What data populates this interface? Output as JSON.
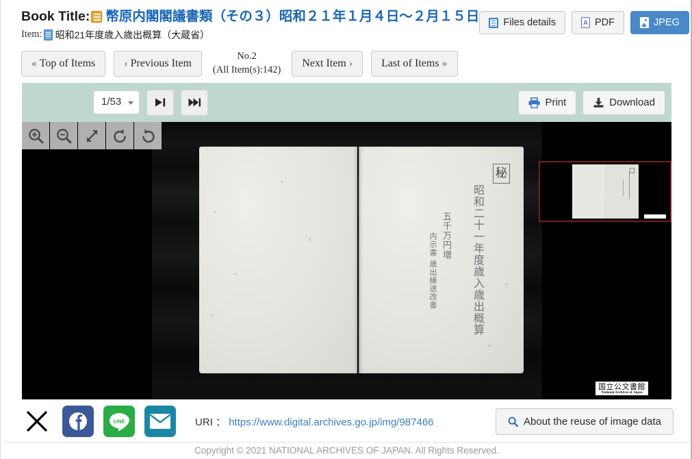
{
  "header": {
    "book_title_label": "Book Title:",
    "book_title_value": "幣原内閣閣議書類（その３）昭和２１年１月４日〜２月１５日",
    "item_label": "Item:",
    "item_value": "昭和21年度歳入歳出概算（大蔵省）",
    "actions": [
      {
        "name": "files-details",
        "label": "Files details",
        "icon": "list-icon",
        "primary": false
      },
      {
        "name": "pdf",
        "label": "PDF",
        "icon": "pdf-icon",
        "primary": false
      },
      {
        "name": "jpeg",
        "label": "JPEG",
        "icon": "image-icon",
        "primary": true
      }
    ]
  },
  "item_nav": {
    "top_of_items": "Top of Items",
    "previous_item": "Previous Item",
    "next_item": "Next Item",
    "last_of_items": "Last of Items",
    "chev_first": "«",
    "chev_prev": "‹",
    "chev_next": "›",
    "chev_last": "»",
    "counter_current": "No.2",
    "counter_total": "(All Item(s):142)"
  },
  "viewer": {
    "page_select_value": "1/53",
    "next_page_title": "Next page",
    "last_page_title": "Last page",
    "print_label": "Print",
    "download_label": "Download",
    "zoom_tools": [
      {
        "name": "zoom-in-icon",
        "title": "Zoom in"
      },
      {
        "name": "zoom-out-icon",
        "title": "Zoom out"
      },
      {
        "name": "fit-expand-icon",
        "title": "Fit / expand"
      },
      {
        "name": "rotate-left-icon",
        "title": "Rotate left"
      },
      {
        "name": "rotate-right-icon",
        "title": "Rotate right"
      }
    ],
    "scan": {
      "seal_text": "秘",
      "vertical_main": "昭和二十一年度歳入歳出概算",
      "vertical_sub1": "五千万円増",
      "vertical_sub2": "内示書 歳出繰送改書",
      "watermark_jp": "国立公文書館",
      "watermark_en": "National Archives of Japan"
    }
  },
  "footer": {
    "share": [
      {
        "name": "share-x",
        "label": "X"
      },
      {
        "name": "share-facebook",
        "label": "Facebook"
      },
      {
        "name": "share-line",
        "label": "LINE"
      },
      {
        "name": "share-email",
        "label": "Email"
      }
    ],
    "uri_label": "URI ：",
    "uri_value": "https://www.digital.archives.go.jp/img/987466",
    "reuse_label": "About the reuse of image data",
    "copyright": "Copyright © 2021 NATIONAL ARCHIVES OF JAPAN. All Rights Reserved."
  },
  "colors": {
    "accent_blue": "#1967b5",
    "primary_button": "#4a89c8",
    "toolbar_green": "#bfd8cd",
    "link_blue": "#3a7fc1",
    "navigator_border": "#7b1d1d"
  }
}
